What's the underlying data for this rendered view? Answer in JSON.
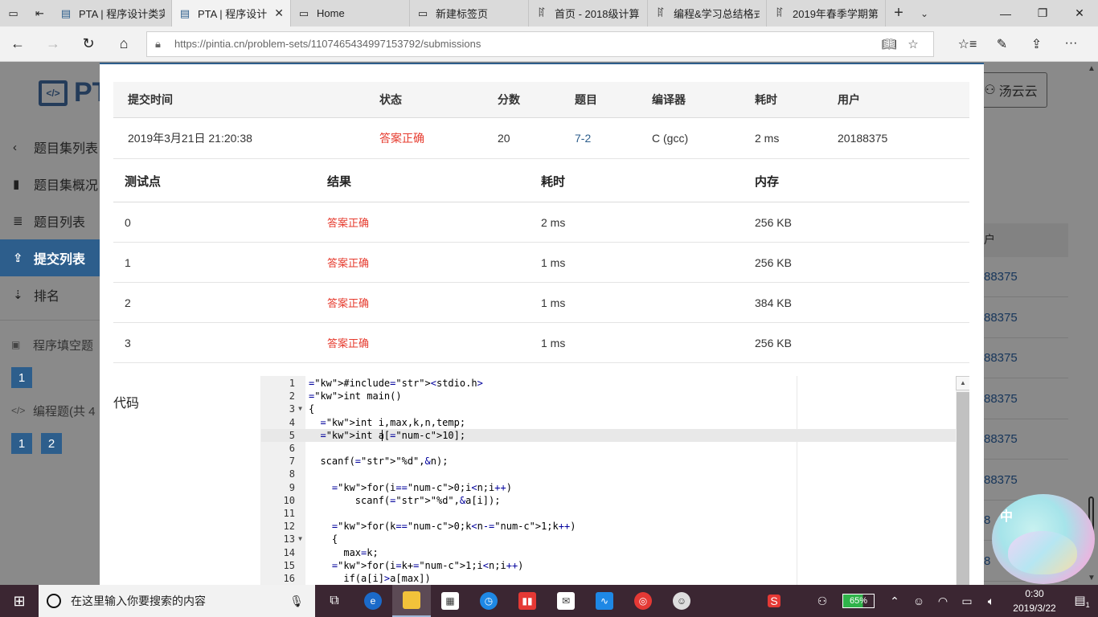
{
  "browser": {
    "tabs": [
      {
        "title": "PTA | 程序设计类实",
        "icon": "pta-icon",
        "active": false
      },
      {
        "title": "PTA | 程序设计",
        "icon": "pta-icon",
        "active": true
      },
      {
        "title": "Home",
        "icon": "page-icon",
        "active": false
      },
      {
        "title": "新建标签页",
        "icon": "page-icon",
        "active": false
      },
      {
        "title": "首页 - 2018级计算",
        "icon": "blog-icon",
        "active": false
      },
      {
        "title": "编程&学习总结格式",
        "icon": "blog-icon",
        "active": false
      },
      {
        "title": "2019年春季学期第",
        "icon": "blog-icon",
        "active": false
      }
    ],
    "url": "https://pintia.cn/problem-sets/1107465434997153792/submissions"
  },
  "background_page": {
    "logo_text": "PT",
    "user_button": "汤云云",
    "sidebar": {
      "items": [
        {
          "label": "题目集列表",
          "icon": "chevron-left-icon"
        },
        {
          "label": "题目集概况",
          "icon": "book-icon"
        },
        {
          "label": "题目列表",
          "icon": "list-icon"
        },
        {
          "label": "提交列表",
          "icon": "upload-icon",
          "active": true
        },
        {
          "label": "排名",
          "icon": "sort-icon"
        }
      ],
      "section1": {
        "label": "程序填空题",
        "numbers": [
          "1"
        ]
      },
      "section2": {
        "label": "编程题(共 4",
        "numbers": [
          "1",
          "2"
        ]
      }
    },
    "header_fragment": "户",
    "right_column_values": [
      "88375",
      "88375",
      "88375",
      "88375",
      "88375",
      "88375",
      "8",
      "8"
    ]
  },
  "submission": {
    "headers": [
      "提交时间",
      "状态",
      "分数",
      "题目",
      "编译器",
      "耗时",
      "用户"
    ],
    "row": {
      "time": "2019年3月21日 21:20:38",
      "status": "答案正确",
      "score": "20",
      "problem": "7-2",
      "compiler": "C (gcc)",
      "duration": "2 ms",
      "user": "20188375"
    }
  },
  "test_cases": {
    "headers": [
      "测试点",
      "结果",
      "耗时",
      "内存"
    ],
    "rows": [
      {
        "id": "0",
        "result": "答案正确",
        "time": "2 ms",
        "memory": "256 KB"
      },
      {
        "id": "1",
        "result": "答案正确",
        "time": "1 ms",
        "memory": "256 KB"
      },
      {
        "id": "2",
        "result": "答案正确",
        "time": "1 ms",
        "memory": "384 KB"
      },
      {
        "id": "3",
        "result": "答案正确",
        "time": "1 ms",
        "memory": "256 KB"
      }
    ]
  },
  "code": {
    "label": "代码",
    "lines": [
      "#include<stdio.h>",
      "int main()",
      "{",
      "  int i,max,k,n,temp;",
      "  int a[10];",
      "",
      "  scanf(\"%d\",&n);",
      "",
      "    for(i=0;i<n;i++)",
      "        scanf(\"%d\",&a[i]);",
      "",
      "    for(k=0;k<n-1;k++)",
      "    {",
      "      max=k;",
      "    for(i=k+1;i<n;i++)",
      "      if(a[i]>a[max])"
    ],
    "fold_lines": [
      3,
      13
    ],
    "highlight_line": 5
  },
  "widget": {
    "text": "中"
  },
  "taskbar": {
    "search_placeholder": "在这里输入你要搜索的内容",
    "battery": "65%",
    "time": "0:30",
    "date": "2019/3/22",
    "notifications": "1"
  }
}
